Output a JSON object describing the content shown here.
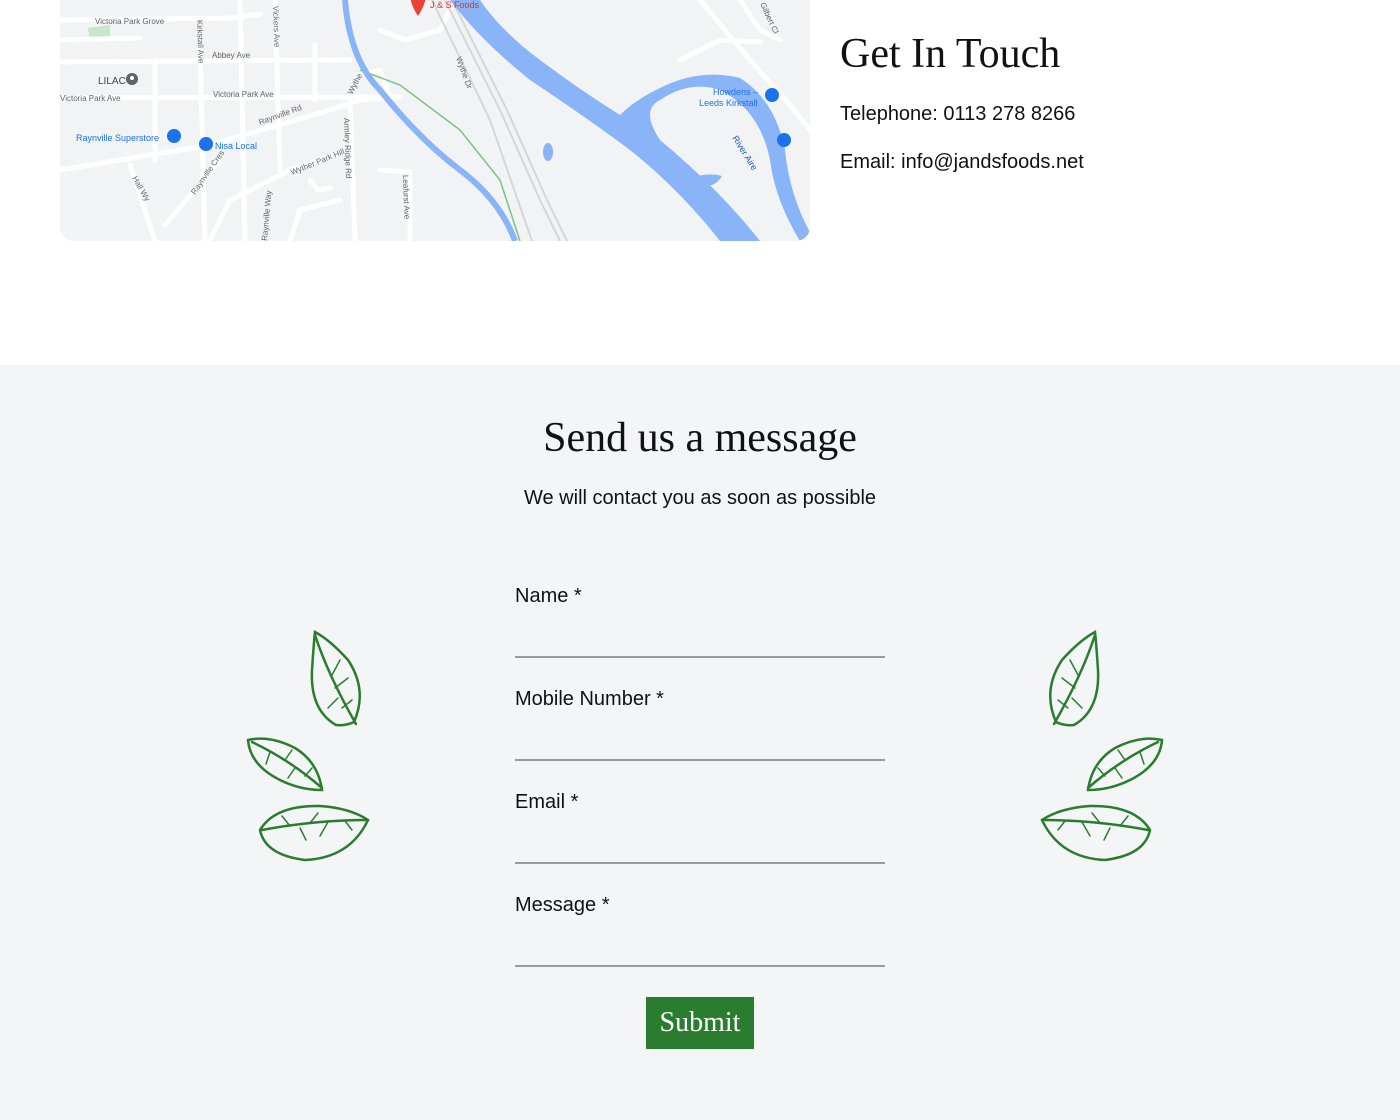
{
  "map": {
    "pin_label": "J & S Foods",
    "labels": {
      "victoria_park_grove": "Victoria Park Grove",
      "kirkstall_ave": "Kirkstall Ave",
      "vickers_ave": "Vickers Ave",
      "abbey_ave": "Abbey Ave",
      "lilac": "LILAC",
      "victoria_park_ave_left": "Victoria Park Ave",
      "victoria_park_ave": "Victoria Park Ave",
      "raynville_rd": "Raynville Rd",
      "raynville_superstore": "Raynville Superstore",
      "nisa_local": "Nisa Local",
      "hall_wy": "Hall Wy",
      "raynville_cres": "Raynville Cres",
      "wyther_park_hill": "Wyther Park Hill",
      "armley_ridge_rd": "Armley Ridge Rd",
      "leafurst_ave": "Leafurst Ave",
      "wythe": "Wythe",
      "wythe_dr": "Wythe Dr",
      "gilbert_cl": "Gilbert Cl",
      "howdens_line1": "Howdens –",
      "howdens_line2": "Leeds Kirkstall",
      "river_aire": "River Aire",
      "raynville_way": "Raynville Way"
    }
  },
  "contact": {
    "heading": "Get In Touch",
    "telephone": "Telephone: 0113 278 8266",
    "email": "Email: info@jandsfoods.net"
  },
  "message": {
    "title": "Send us a message",
    "subtitle": "We will contact you as soon as possible",
    "fields": [
      {
        "label": "Name *",
        "value": ""
      },
      {
        "label": "Mobile Number *",
        "value": ""
      },
      {
        "label": "Email *",
        "value": ""
      },
      {
        "label": "Message *",
        "value": ""
      }
    ],
    "submit_label": "Submit"
  },
  "colors": {
    "accent_green": "#2a7d2e",
    "section_bg": "#f4f5f7",
    "river_blue": "#8ab4f8",
    "map_bg": "#f1f3f4"
  }
}
